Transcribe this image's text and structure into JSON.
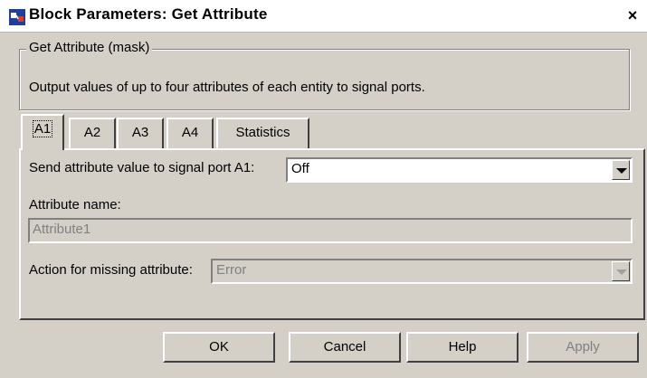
{
  "window": {
    "title": "Block Parameters: Get Attribute",
    "close_glyph": "×"
  },
  "mask": {
    "group_title": "Get Attribute (mask)",
    "description": "Output values of up to four attributes of each entity to signal ports."
  },
  "tabs": [
    {
      "label": "A1",
      "active": true
    },
    {
      "label": "A2",
      "active": false
    },
    {
      "label": "A3",
      "active": false
    },
    {
      "label": "A4",
      "active": false
    },
    {
      "label": "Statistics",
      "active": false
    }
  ],
  "a1": {
    "send_label": "Send attribute value to signal port A1:",
    "send_value": "Off",
    "name_label": "Attribute name:",
    "name_value": "Attribute1",
    "missing_label": "Action for missing attribute:",
    "missing_value": "Error"
  },
  "buttons": {
    "ok": "OK",
    "cancel": "Cancel",
    "help": "Help",
    "apply": "Apply"
  },
  "icons": {
    "app": "simulink-block-icon",
    "dropdown": "chevron-down-icon"
  }
}
